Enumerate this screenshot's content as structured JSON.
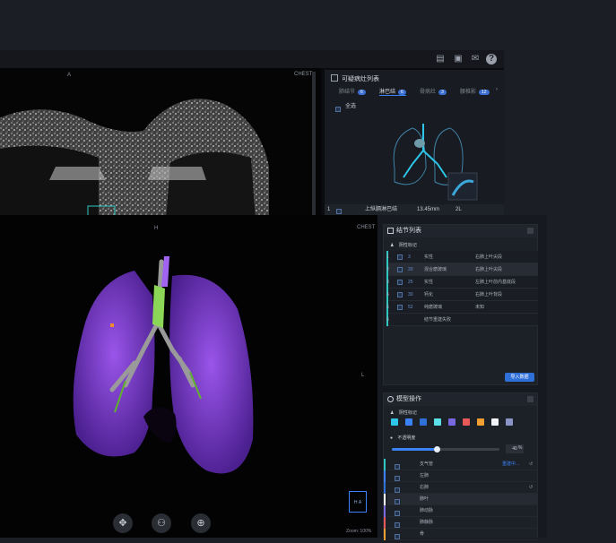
{
  "back_window": {
    "orient_a": "A",
    "chest_label": "CHEST",
    "panel_title": "可疑病灶列表",
    "tabs": [
      {
        "label": "肺结节",
        "count": "6"
      },
      {
        "label": "淋巴结",
        "count": "6"
      },
      {
        "label": "骨病灶",
        "count": "3"
      },
      {
        "label": "腰椎影",
        "count": "12"
      }
    ],
    "select_all": "全选",
    "row": {
      "index": "1",
      "name": "上纵膈淋巴结",
      "size": "13.45mm",
      "extra": "2L"
    }
  },
  "front_window": {
    "orient_h": "H",
    "chest_label": "CHEST",
    "orient_l": "L",
    "zoom_label": "Zoom: 100%",
    "nodule_panel": {
      "title": "结节列表",
      "section_label": "阴性标记",
      "rows": [
        {
          "num": "1",
          "id": "3",
          "type": "实性",
          "location": "右肺上叶尖段"
        },
        {
          "num": "2",
          "id": "20",
          "type": "混合磨玻璃",
          "location": "右肺上叶尖段"
        },
        {
          "num": "3",
          "id": "25",
          "type": "实性",
          "location": "左肺上叶前内基底段"
        },
        {
          "num": "4",
          "id": "30",
          "type": "钙化",
          "location": "右肺上叶背段"
        },
        {
          "num": "5",
          "id": "52",
          "type": "纯磨玻璃",
          "location": "未知"
        },
        {
          "num": "6",
          "id": "",
          "type": "结节重建失败",
          "location": ""
        }
      ],
      "import_button": "导入数据"
    },
    "model_panel": {
      "title": "模型操作",
      "section_label": "阴性标记",
      "swatch_colors": [
        "#2ec6e8",
        "#3b82f6",
        "#2f6fd8",
        "#5ce0e8",
        "#7a68e0",
        "#e85a5a",
        "#f0a030",
        "#f2f4f8",
        "#8a96c8"
      ],
      "opacity_label": "不透明度",
      "opacity_value": "40",
      "opacity_unit": "%",
      "opacity_level": 0.42,
      "layers": [
        {
          "name": "支气管",
          "status": "重建中...",
          "color": "#2ec6c2"
        },
        {
          "name": "左肺",
          "status": "",
          "color": "#3b82f6"
        },
        {
          "name": "右肺",
          "status": "",
          "color": "#2f6fd8"
        },
        {
          "name": "肺叶",
          "status": "",
          "color": "#ffffff"
        },
        {
          "name": "肺动脉",
          "status": "",
          "color": "#7a68e0"
        },
        {
          "name": "肺静脉",
          "status": "",
          "color": "#e85a5a"
        },
        {
          "name": "骨",
          "status": "",
          "color": "#f0a030"
        }
      ]
    }
  },
  "toolbar_icons": [
    "move-icon",
    "brain-icon",
    "zoom-icon"
  ]
}
